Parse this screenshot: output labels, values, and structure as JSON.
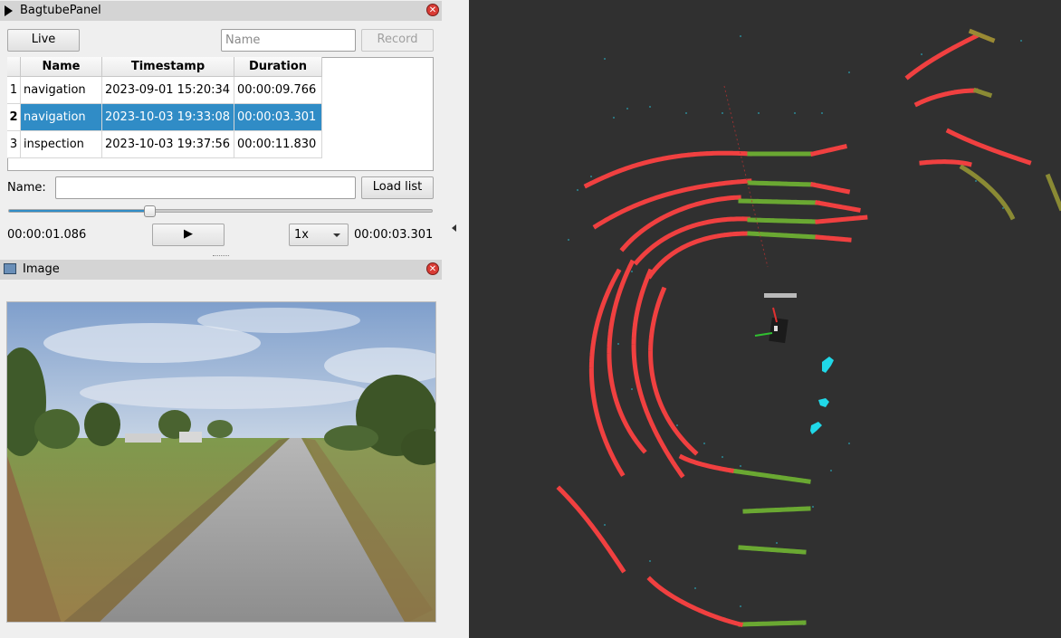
{
  "bagtube_panel": {
    "title": "BagtubePanel",
    "live_label": "Live",
    "name_placeholder": "Name",
    "record_label": "Record",
    "columns": [
      "Name",
      "Timestamp",
      "Duration"
    ],
    "rows": [
      {
        "index": "1",
        "name": "navigation",
        "timestamp": "2023-09-01 15:20:34",
        "duration": "00:00:09.766",
        "selected": false
      },
      {
        "index": "2",
        "name": "navigation",
        "timestamp": "2023-10-03 19:33:08",
        "duration": "00:00:03.301",
        "selected": true
      },
      {
        "index": "3",
        "name": "inspection",
        "timestamp": "2023-10-03 19:37:56",
        "duration": "00:00:11.830",
        "selected": false
      }
    ],
    "name_label": "Name:",
    "name_value": "",
    "load_list_label": "Load list",
    "playback": {
      "progress_fraction": 0.33,
      "current_time": "00:00:01.086",
      "play_icon": "play-icon",
      "speed": "1x",
      "total_time": "00:00:03.301"
    }
  },
  "image_panel": {
    "title": "Image"
  },
  "colors": {
    "selection": "#308cc6",
    "viz_background": "#303030",
    "laser_red": "#f04040",
    "laser_green": "#6aa832",
    "pointcloud_cyan": "#2aa5b8",
    "person_cyan": "#20d8e8"
  }
}
